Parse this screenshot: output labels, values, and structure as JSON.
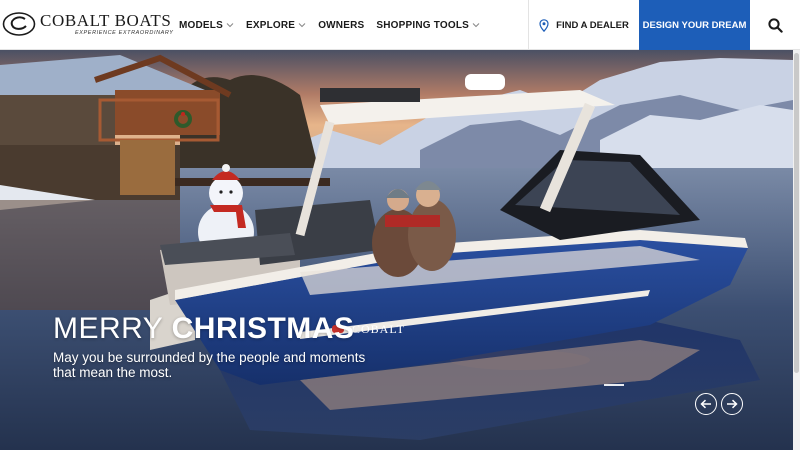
{
  "header": {
    "logo": {
      "name": "COBALT BOATS",
      "tagline": "EXPERIENCE EXTRAORDINARY"
    },
    "nav": [
      {
        "label": "MODELS",
        "has_dropdown": true
      },
      {
        "label": "EXPLORE",
        "has_dropdown": true
      },
      {
        "label": "OWNERS",
        "has_dropdown": false
      },
      {
        "label": "SHOPPING TOOLS",
        "has_dropdown": true
      }
    ],
    "find_dealer": {
      "label": "FIND A DEALER",
      "icon": "map-pin-icon"
    },
    "design_button": {
      "label": "DESIGN YOUR DREAM"
    },
    "search": {
      "icon": "search-icon"
    }
  },
  "hero": {
    "title_light": "MERRY",
    "title_bold": "CHRISTMAS",
    "subtitle": "May you be surrounded by the people and moments that mean the most.",
    "boat_brand": "COBALT",
    "prev_icon": "arrow-left-icon",
    "next_icon": "arrow-right-icon"
  },
  "colors": {
    "accent": "#1d5eb8",
    "text": "#1a1a1a",
    "hull": "#1f3f8a"
  }
}
